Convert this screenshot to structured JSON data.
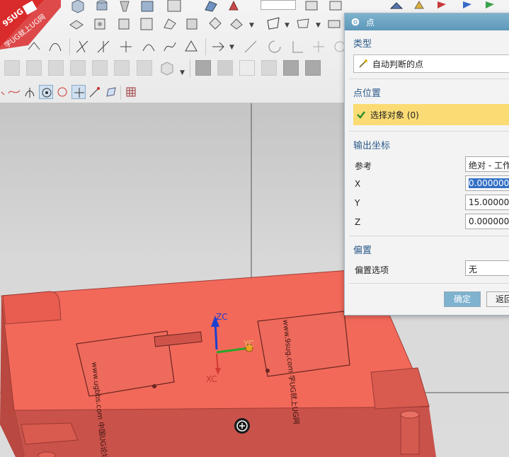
{
  "logo": {
    "brand": "9SUG",
    "slogan": "学UG就上UG网"
  },
  "dialog": {
    "title": "点",
    "type_section": "类型",
    "type_value": "自动判断的点",
    "point_location_section": "点位置",
    "select_object": "选择对象 (0)",
    "output_coords_section": "输出坐标",
    "reference_label": "参考",
    "reference_value": "绝对 - 工作",
    "x_label": "X",
    "x_value": "0.0000000",
    "y_label": "Y",
    "y_value": "15.0000000",
    "z_label": "Z",
    "z_value": "0.0000000",
    "offset_section": "偏置",
    "offset_option_label": "偏置选项",
    "offset_option_value": "无",
    "ok_button": "确定",
    "back_button": "返回"
  },
  "viewport": {
    "axis_zc": "ZC",
    "axis_yc": "YC",
    "axis_xc": "XC",
    "part_text_left": "www.ugbbs.com 中国UG论坛",
    "part_text_right": "www.9sug.com 学UG就上UG网"
  },
  "colors": {
    "part_face": "#f2695a",
    "part_side": "#c9524a",
    "accent_title": "#6aa7c8",
    "highlight_bar": "#fbdc74",
    "ok_button": "#7fb2cf"
  }
}
